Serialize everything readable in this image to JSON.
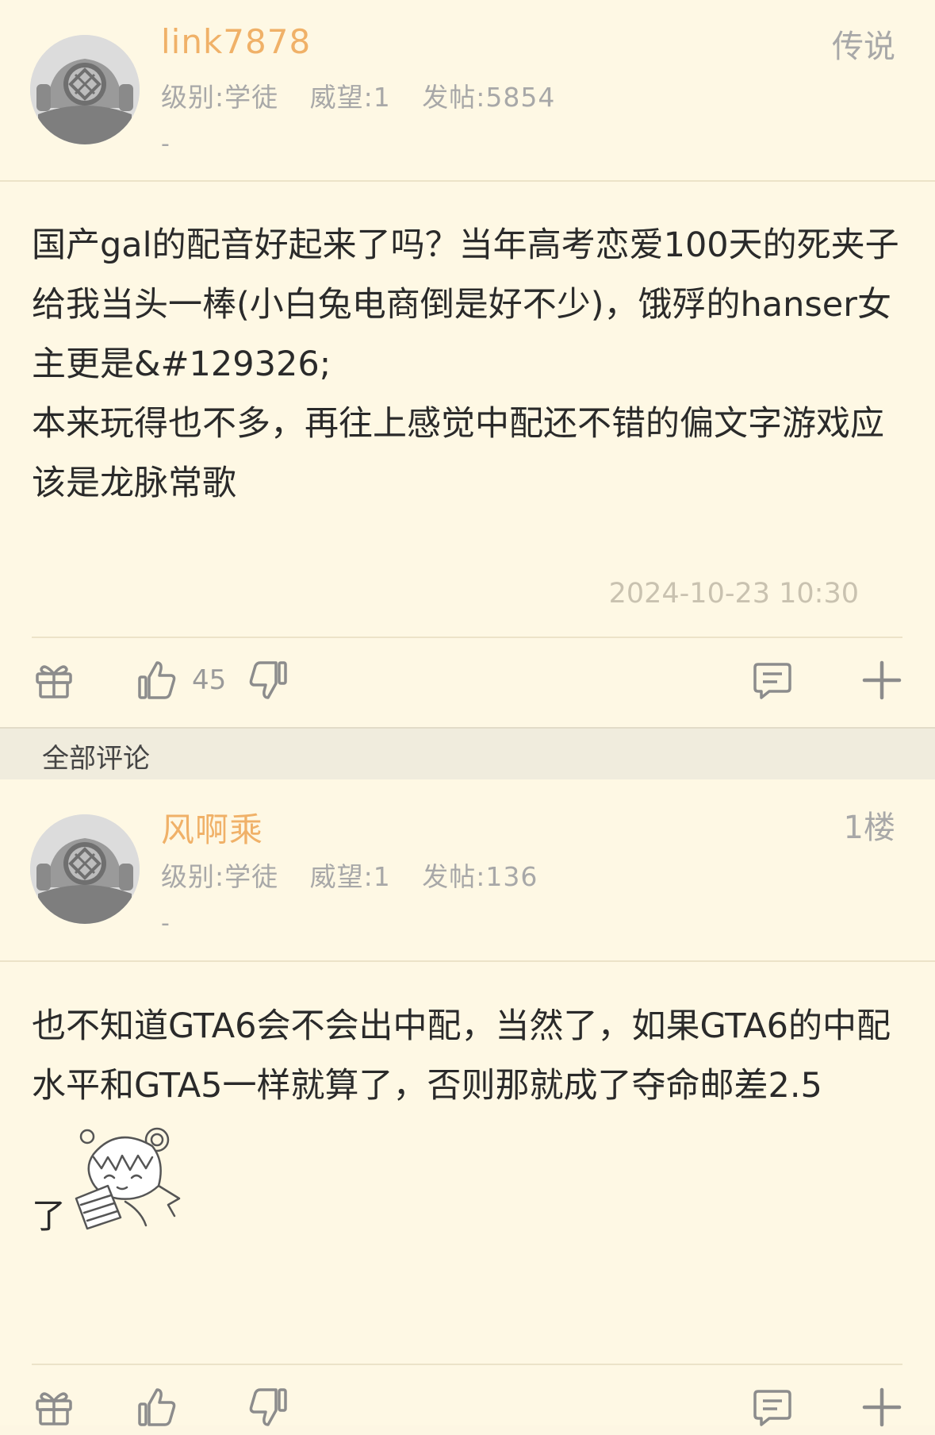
{
  "main_post": {
    "username": "link7878",
    "level": "级别:学徒",
    "prestige": "威望:1",
    "posts": "发帖:5854",
    "dash": "-",
    "badge": "传说",
    "content": "国产gal的配音好起来了吗？当年高考恋爱100天的死夹子给我当头一棒(小白兔电商倒是好不少)，饿殍的hanser女主更是&#129326;\n本来玩得也不多，再往上感觉中配还不错的偏文字游戏应该是龙脉常歌",
    "timestamp": "2024-10-23 10:30",
    "like_count": "45"
  },
  "section": {
    "title": "全部评论"
  },
  "comment": {
    "username": "风啊乘",
    "level": "级别:学徒",
    "prestige": "威望:1",
    "posts": "发帖:136",
    "dash": "-",
    "floor": "1楼",
    "content": "也不知道GTA6会不会出中配，当然了，如果GTA6的中配水平和GTA5一样就算了，否则那就成了夺命邮差2.5",
    "content_tail": "了",
    "sticker": "anime-sticker-icon"
  },
  "colors": {
    "username": "#f0b168",
    "meta": "#a8a8a8",
    "background": "#fef8e4",
    "icon": "#8c8c8c"
  }
}
